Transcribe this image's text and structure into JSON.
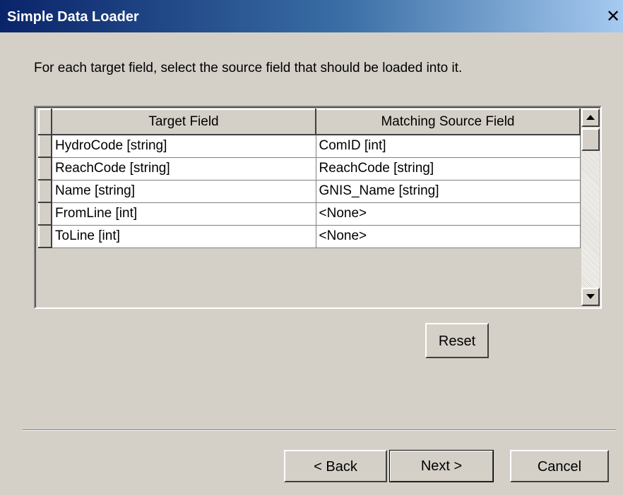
{
  "window": {
    "title": "Simple Data Loader",
    "close_glyph": "✕"
  },
  "instruction": "For each target field, select the source field that should be loaded into it.",
  "grid": {
    "headers": {
      "target": "Target Field",
      "source": "Matching Source Field"
    },
    "rows": [
      {
        "target": "HydroCode [string]",
        "source": "ComID [int]"
      },
      {
        "target": "ReachCode [string]",
        "source": "ReachCode [string]"
      },
      {
        "target": "Name [string]",
        "source": "GNIS_Name [string]"
      },
      {
        "target": "FromLine [int]",
        "source": "<None>"
      },
      {
        "target": "ToLine [int]",
        "source": "<None>"
      }
    ]
  },
  "buttons": {
    "reset": "Reset",
    "back": "< Back",
    "next": "Next >",
    "cancel": "Cancel"
  },
  "icons": {
    "close": "close-icon",
    "scroll_up": "arrow-up-icon",
    "scroll_down": "arrow-down-icon"
  }
}
